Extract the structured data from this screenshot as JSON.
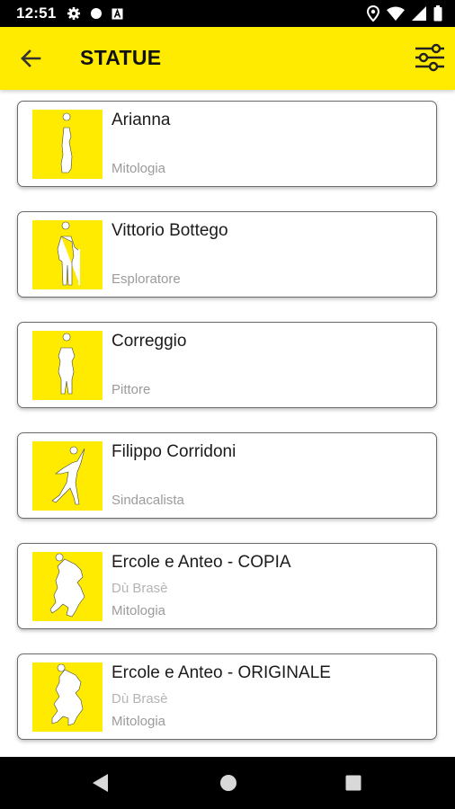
{
  "status_bar": {
    "time": "12:51",
    "left_icons": [
      "gear-icon",
      "circle-icon",
      "a-box-icon"
    ],
    "right_icons": [
      "location-icon",
      "wifi-icon",
      "signal-icon",
      "battery-icon"
    ]
  },
  "app_bar": {
    "title": "STATUE",
    "back_icon": "arrow-left-icon",
    "filter_icon": "sliders-icon",
    "color": "#ffeb00"
  },
  "statues": [
    {
      "name": "Arianna",
      "subtitle": "",
      "category": "Mitologia"
    },
    {
      "name": "Vittorio Bottego",
      "subtitle": "",
      "category": "Esploratore"
    },
    {
      "name": "Correggio",
      "subtitle": "",
      "category": "Pittore"
    },
    {
      "name": "Filippo Corridoni",
      "subtitle": "",
      "category": "Sindacalista"
    },
    {
      "name": "Ercole e Anteo - COPIA",
      "subtitle": "Dù Brasè",
      "category": "Mitologia"
    },
    {
      "name": "Ercole e Anteo - ORIGINALE",
      "subtitle": "Dù Brasè",
      "category": "Mitologia"
    }
  ],
  "nav_bar": {
    "icons": [
      "triangle-back-icon",
      "circle-home-icon",
      "square-recents-icon"
    ]
  }
}
